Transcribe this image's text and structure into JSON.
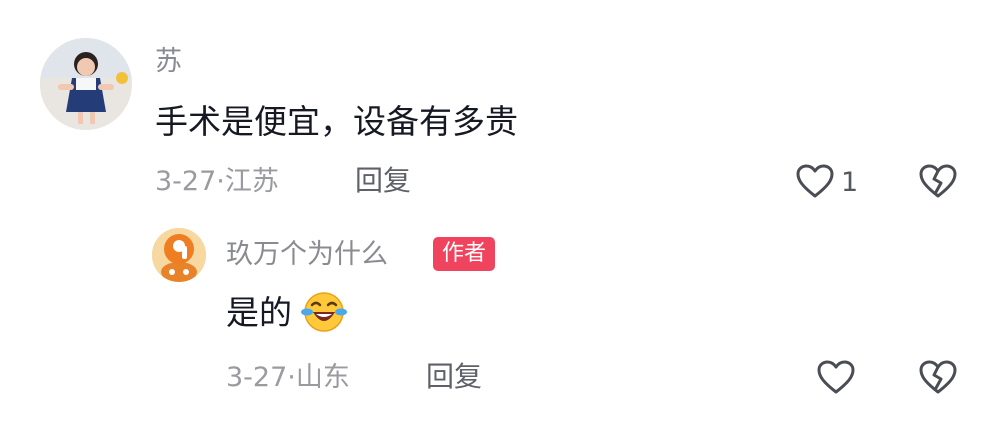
{
  "comments": [
    {
      "username": "苏",
      "text": "手术是便宜，设备有多贵",
      "date": "3-27",
      "location": "江苏",
      "reply_label": "回复",
      "like_count": "1",
      "avatar": "child-photo-avatar"
    }
  ],
  "reply": {
    "username": "玖万个为什么",
    "badge": "作者",
    "text": "是的",
    "emoji": "crying-laughing-emoji",
    "date": "3-27",
    "location": "山东",
    "reply_label": "回复",
    "avatar": "orange-number-9-avatar"
  },
  "separator": "·",
  "colors": {
    "badge": "#f0435e",
    "text": "#161823",
    "muted": "#9a9ba0"
  }
}
